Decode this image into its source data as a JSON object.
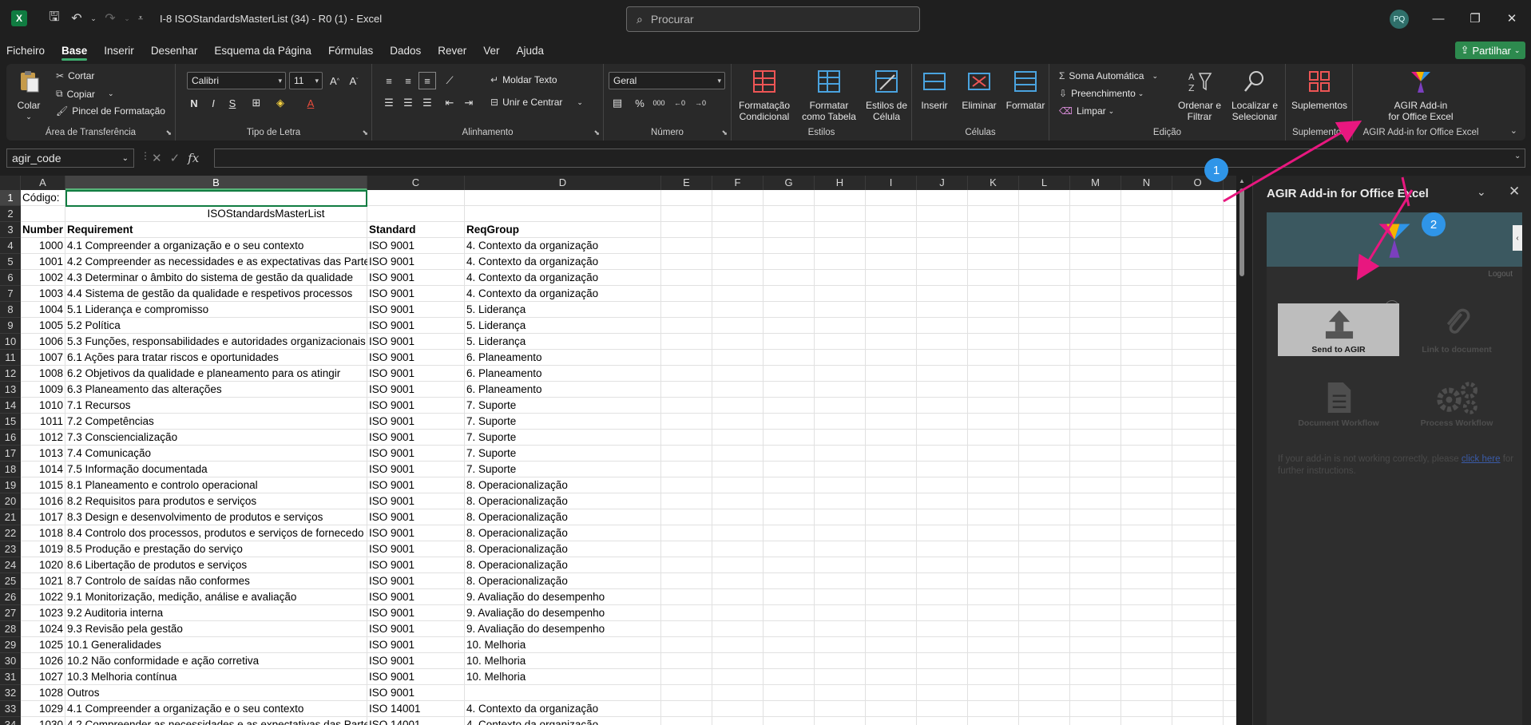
{
  "window": {
    "title": "I-8 ISOStandardsMasterList (34) - R0 (1)  -  Excel",
    "search_placeholder": "Procurar",
    "avatar": "PQ",
    "minimize": "—",
    "restore": "❐",
    "close": "✕"
  },
  "menu": {
    "tabs": [
      "Ficheiro",
      "Base",
      "Inserir",
      "Desenhar",
      "Esquema da Página",
      "Fórmulas",
      "Dados",
      "Rever",
      "Ver",
      "Ajuda"
    ],
    "active": "Base",
    "share": "Partilhar"
  },
  "ribbon": {
    "clipboard": {
      "label": "Área de Transferência",
      "paste": "Colar",
      "cut": "Cortar",
      "copy": "Copiar",
      "painter": "Pincel de Formatação"
    },
    "font": {
      "label": "Tipo de Letra",
      "name": "Calibri",
      "size": "11"
    },
    "alignment": {
      "label": "Alinhamento",
      "wrap": "Moldar Texto",
      "merge": "Unir e Centrar"
    },
    "number": {
      "label": "Número",
      "format": "Geral"
    },
    "styles": {
      "label": "Estilos",
      "cond": "Formatação Condicional",
      "table": "Formatar como Tabela",
      "cell": "Estilos de Célula"
    },
    "cells": {
      "label": "Células",
      "insert": "Inserir",
      "delete": "Eliminar",
      "format": "Formatar"
    },
    "editing": {
      "label": "Edição",
      "autosum": "Soma Automática",
      "fill": "Preenchimento",
      "clear": "Limpar",
      "sort": "Ordenar e Filtrar",
      "find": "Localizar e Selecionar"
    },
    "addins": {
      "label": "Suplementos",
      "btn": "Suplementos"
    },
    "agir": {
      "label": "AGIR Add-in for Office Excel",
      "btn1": "AGIR Add-in",
      "btn2": "for Office Excel"
    }
  },
  "formula": {
    "namebox": "agir_code",
    "fx": "fx",
    "value": ""
  },
  "columns": [
    "A",
    "B",
    "C",
    "D",
    "E",
    "F",
    "G",
    "H",
    "I",
    "J",
    "K",
    "L",
    "M",
    "N",
    "O"
  ],
  "rows": [
    {
      "n": "1",
      "a": "Código:",
      "b": "",
      "c": "",
      "d": ""
    },
    {
      "n": "2",
      "a": "",
      "b": "ISOStandardsMasterList",
      "c": "",
      "d": ""
    },
    {
      "n": "3",
      "a": "Number",
      "b": "Requirement",
      "c": "Standard",
      "d": "ReqGroup",
      "header": true
    },
    {
      "n": "4",
      "a": "1000",
      "b": "4.1 Compreender a organização e o seu contexto",
      "c": "ISO 9001",
      "d": "4. Contexto da organização"
    },
    {
      "n": "5",
      "a": "1001",
      "b": "4.2 Compreender  as necessidades e as expectativas das Parte",
      "c": "ISO 9001",
      "d": "4. Contexto da organização"
    },
    {
      "n": "6",
      "a": "1002",
      "b": "4.3 Determinar o âmbito do sistema de gestão da qualidade",
      "c": "ISO 9001",
      "d": "4. Contexto da organização"
    },
    {
      "n": "7",
      "a": "1003",
      "b": "4.4 Sistema de gestão da qualidade e respetivos processos",
      "c": "ISO 9001",
      "d": "4. Contexto da organização"
    },
    {
      "n": "8",
      "a": "1004",
      "b": "5.1 Liderança e compromisso",
      "c": "ISO 9001",
      "d": "5. Liderança"
    },
    {
      "n": "9",
      "a": "1005",
      "b": "5.2 Política",
      "c": "ISO 9001",
      "d": "5. Liderança"
    },
    {
      "n": "10",
      "a": "1006",
      "b": "5.3 Funções, responsabilidades e autoridades organizacionais",
      "c": "ISO 9001",
      "d": "5. Liderança"
    },
    {
      "n": "11",
      "a": "1007",
      "b": "6.1 Ações para tratar riscos e oportunidades",
      "c": "ISO 9001",
      "d": "6. Planeamento"
    },
    {
      "n": "12",
      "a": "1008",
      "b": "6.2 Objetivos da qualidade e planeamento para os atingir",
      "c": "ISO 9001",
      "d": "6. Planeamento"
    },
    {
      "n": "13",
      "a": "1009",
      "b": "6.3 Planeamento das alterações",
      "c": "ISO 9001",
      "d": "6. Planeamento"
    },
    {
      "n": "14",
      "a": "1010",
      "b": "7.1 Recursos",
      "c": "ISO 9001",
      "d": "7. Suporte"
    },
    {
      "n": "15",
      "a": "1011",
      "b": "7.2 Competências",
      "c": "ISO 9001",
      "d": "7. Suporte"
    },
    {
      "n": "16",
      "a": "1012",
      "b": "7.3 Consciencialização",
      "c": "ISO 9001",
      "d": "7. Suporte"
    },
    {
      "n": "17",
      "a": "1013",
      "b": "7.4 Comunicação",
      "c": "ISO 9001",
      "d": "7. Suporte"
    },
    {
      "n": "18",
      "a": "1014",
      "b": "7.5 Informação documentada",
      "c": "ISO 9001",
      "d": "7. Suporte"
    },
    {
      "n": "19",
      "a": "1015",
      "b": "8.1 Planeamento e controlo operacional",
      "c": "ISO 9001",
      "d": "8. Operacionalização"
    },
    {
      "n": "20",
      "a": "1016",
      "b": "8.2 Requisitos para produtos e serviços",
      "c": "ISO 9001",
      "d": "8. Operacionalização"
    },
    {
      "n": "21",
      "a": "1017",
      "b": "8.3 Design e desenvolvimento de produtos e serviços",
      "c": "ISO 9001",
      "d": "8. Operacionalização"
    },
    {
      "n": "22",
      "a": "1018",
      "b": "8.4 Controlo dos processos, produtos e serviços de fornecedo",
      "c": "ISO 9001",
      "d": "8. Operacionalização"
    },
    {
      "n": "23",
      "a": "1019",
      "b": "8.5 Produção e prestação do serviço",
      "c": "ISO 9001",
      "d": "8. Operacionalização"
    },
    {
      "n": "24",
      "a": "1020",
      "b": "8.6 Libertação de produtos e serviços",
      "c": "ISO 9001",
      "d": "8. Operacionalização"
    },
    {
      "n": "25",
      "a": "1021",
      "b": "8.7 Controlo de saídas não conformes",
      "c": "ISO 9001",
      "d": "8. Operacionalização"
    },
    {
      "n": "26",
      "a": "1022",
      "b": "9.1 Monitorização, medição, análise e avaliação",
      "c": "ISO 9001",
      "d": "9. Avaliação do desempenho"
    },
    {
      "n": "27",
      "a": "1023",
      "b": "9.2 Auditoria interna",
      "c": "ISO 9001",
      "d": "9. Avaliação do desempenho"
    },
    {
      "n": "28",
      "a": "1024",
      "b": "9.3 Revisão pela gestão",
      "c": "ISO 9001",
      "d": "9. Avaliação do desempenho"
    },
    {
      "n": "29",
      "a": "1025",
      "b": "10.1 Generalidades",
      "c": "ISO 9001",
      "d": "10. Melhoria"
    },
    {
      "n": "30",
      "a": "1026",
      "b": "10.2 Não conformidade e ação corretiva",
      "c": "ISO 9001",
      "d": "10. Melhoria"
    },
    {
      "n": "31",
      "a": "1027",
      "b": "10.3 Melhoria contínua",
      "c": "ISO 9001",
      "d": "10. Melhoria"
    },
    {
      "n": "32",
      "a": "1028",
      "b": "Outros",
      "c": "ISO 9001",
      "d": ""
    },
    {
      "n": "33",
      "a": "1029",
      "b": "4.1 Compreender a organização e o seu contexto",
      "c": "ISO 14001",
      "d": "4. Contexto da organização"
    },
    {
      "n": "34",
      "a": "1030",
      "b": "4.2 Compreender  as necessidades e as expectativas das Parte",
      "c": "ISO 14001",
      "d": "4. Contexto da organização"
    }
  ],
  "pane": {
    "title": "AGIR Add-in for Office Excel",
    "logout": "Logout",
    "tiles": [
      {
        "label": "Send to AGIR",
        "icon": "upload-icon"
      },
      {
        "label": "Link to document",
        "icon": "paperclip-icon"
      },
      {
        "label": "Document Workflow",
        "icon": "document-icon"
      },
      {
        "label": "Process Workflow",
        "icon": "gears-icon"
      }
    ],
    "note_pre": "If your add-in is not working correctly, please",
    "note_link": "click here",
    "note_post": "for further instructions."
  },
  "annotations": {
    "badge1": "1",
    "badge2": "2",
    "arrow_color": "#e8177f"
  },
  "colors": {
    "excel_green": "#107c41",
    "badge_blue": "#2f95e8"
  }
}
